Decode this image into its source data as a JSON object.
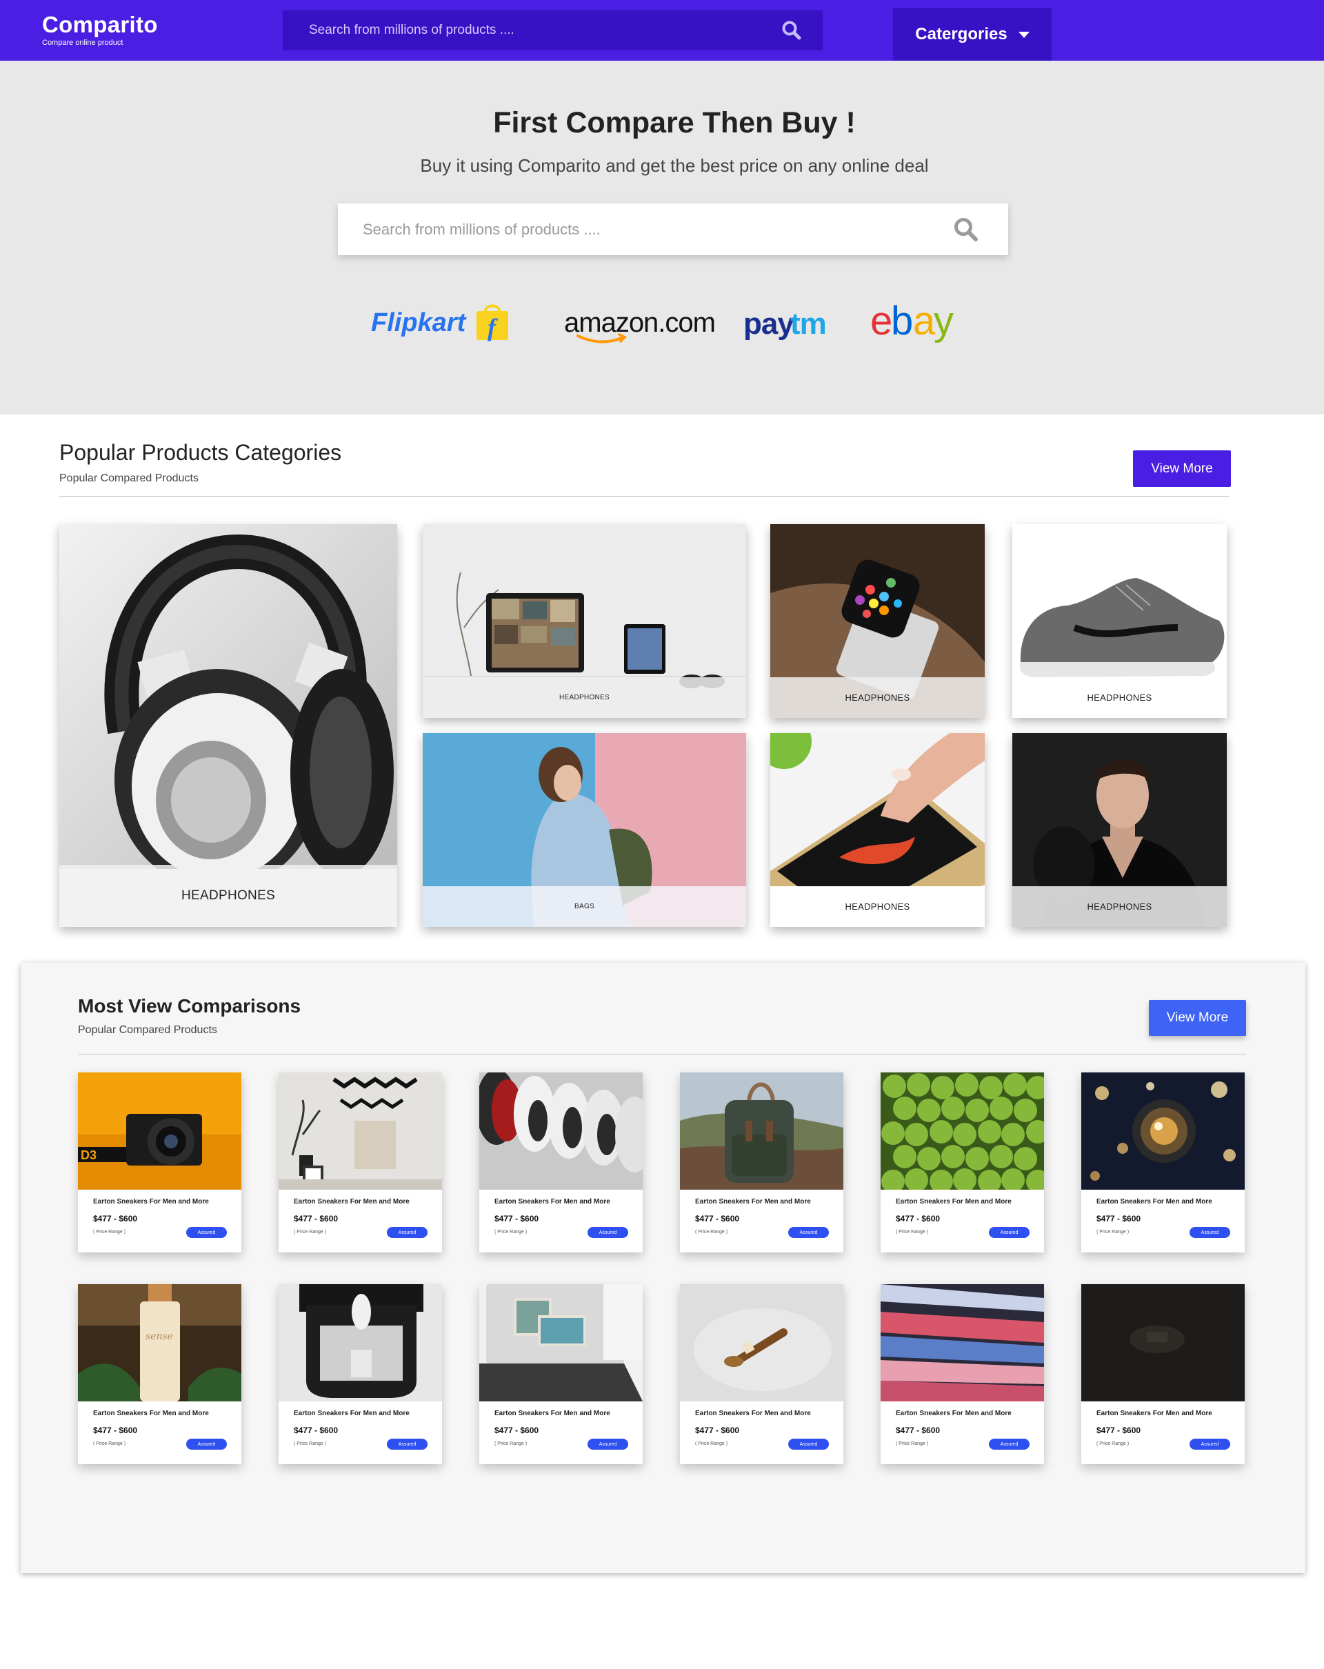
{
  "nav": {
    "logo_name": "Comparito",
    "logo_tagline": "Compare online product",
    "search_placeholder": "Search from millions of products ....",
    "categories_label": "Catergories"
  },
  "hero": {
    "title": "First Compare Then Buy !",
    "subtitle": "Buy it using Comparito and get the best price on any online deal",
    "search_placeholder": "Search from millions of products ....",
    "brands": [
      "Flipkart",
      "amazon.com",
      "paytm",
      "ebay"
    ]
  },
  "popular": {
    "title": "Popular Products Categories",
    "subtitle": "Popular Compared Products",
    "view_more": "View More",
    "tiles": [
      {
        "label": "HEADPHONES",
        "image": "headphones"
      },
      {
        "label": "HEADPHONES",
        "image": "laptop-desk"
      },
      {
        "label": "HEADPHONES",
        "image": "smartwatch"
      },
      {
        "label": "HEADPHONES",
        "image": "sneaker"
      },
      {
        "label": "BAGS",
        "image": "woman-backpack"
      },
      {
        "label": "HEADPHONES",
        "image": "phone-touch"
      },
      {
        "label": "HEADPHONES",
        "image": "man-portrait"
      }
    ]
  },
  "most_viewed": {
    "title": "Most View Comparisons",
    "subtitle": "Popular Compared Products",
    "view_more": "View More",
    "cards": [
      {
        "title": "Earton Sneakers For Men and More",
        "price": "$477 - $600",
        "range_note": "( Price Range )",
        "badge": "Assured",
        "image": "camera"
      },
      {
        "title": "Earton Sneakers For Men and More",
        "price": "$477 - $600",
        "range_note": "( Price Range )",
        "badge": "Assured",
        "image": "wall-decor"
      },
      {
        "title": "Earton Sneakers For Men and More",
        "price": "$477 - $600",
        "range_note": "( Price Range )",
        "badge": "Assured",
        "image": "shoes"
      },
      {
        "title": "Earton Sneakers For Men and More",
        "price": "$477 - $600",
        "range_note": "( Price Range )",
        "badge": "Assured",
        "image": "backpack"
      },
      {
        "title": "Earton Sneakers For Men and More",
        "price": "$477 - $600",
        "range_note": "( Price Range )",
        "badge": "Assured",
        "image": "limes"
      },
      {
        "title": "Earton Sneakers For Men and More",
        "price": "$477 - $600",
        "range_note": "( Price Range )",
        "badge": "Assured",
        "image": "lens-bokeh"
      },
      {
        "title": "Earton Sneakers For Men and More",
        "price": "$477 - $600",
        "range_note": "( Price Range )",
        "badge": "Assured",
        "image": "bottle"
      },
      {
        "title": "Earton Sneakers For Men and More",
        "price": "$477 - $600",
        "range_note": "( Price Range )",
        "badge": "Assured",
        "image": "vr-headset"
      },
      {
        "title": "Earton Sneakers For Men and More",
        "price": "$477 - $600",
        "range_note": "( Price Range )",
        "badge": "Assured",
        "image": "laptop"
      },
      {
        "title": "Earton Sneakers For Men and More",
        "price": "$477 - $600",
        "range_note": "( Price Range )",
        "badge": "Assured",
        "image": "pipe"
      },
      {
        "title": "Earton Sneakers For Men and More",
        "price": "$477 - $600",
        "range_note": "( Price Range )",
        "badge": "Assured",
        "image": "shoe-shelf"
      },
      {
        "title": "Earton Sneakers For Men and More",
        "price": "$477 - $600",
        "range_note": "( Price Range )",
        "badge": "Assured",
        "image": "dark-object"
      }
    ]
  },
  "colors": {
    "nav_bg": "#4a1fe3",
    "nav_accent": "#3712c4",
    "hero_bg": "#e8e8e8",
    "view_more_primary": "#4a1fe3",
    "view_more_secondary": "#3f63f5",
    "assured_badge": "#2f50f0"
  }
}
